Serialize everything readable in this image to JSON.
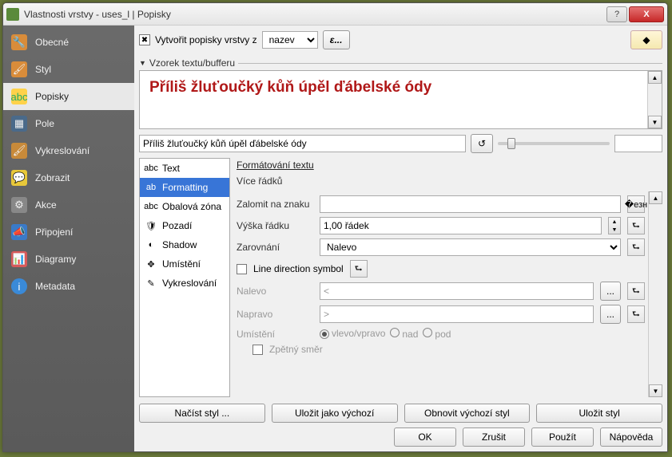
{
  "window": {
    "title": "Vlastnosti vrstvy - uses_l | Popisky"
  },
  "winbtns": {
    "help": "?",
    "close": "X"
  },
  "sidebar": {
    "items": [
      {
        "label": "Obecné"
      },
      {
        "label": "Styl"
      },
      {
        "label": "Popisky"
      },
      {
        "label": "Pole"
      },
      {
        "label": "Vykreslování"
      },
      {
        "label": "Zobrazit"
      },
      {
        "label": "Akce"
      },
      {
        "label": "Připojení"
      },
      {
        "label": "Diagramy"
      },
      {
        "label": "Metadata"
      }
    ]
  },
  "top": {
    "checkbox_label": "Vytvořit popisky vrstvy z",
    "field": "nazev",
    "eps": "ε..."
  },
  "sample": {
    "header": "Vzorek textu/bufferu",
    "preview": "Příliš žluťoučký kůň úpěl ďábelské ódy",
    "input": "Příliš žluťoučký kůň úpěl ďábelské ódy"
  },
  "tabs": [
    "Text",
    "Formatting",
    "Obalová zóna",
    "Pozadí",
    "Shadow",
    "Umístění",
    "Vykreslování"
  ],
  "form": {
    "title": "Formátování textu",
    "subtitle": "Více řádků",
    "wrap_label": "Zalomit na znaku",
    "lineheight_label": "Výška řádku",
    "lineheight_value": "1,00 řádek",
    "align_label": "Zarovnání",
    "align_value": "Nalevo",
    "linedir_label": "Line direction symbol",
    "left_label": "Nalevo",
    "left_value": "<",
    "right_label": "Napravo",
    "right_value": ">",
    "placement_label": "Umístění",
    "placement_opts": [
      "vlevo/vpravo",
      "nad",
      "pod"
    ],
    "reverse_label": "Zpětný směr"
  },
  "stylebar": {
    "load": "Načíst styl ...",
    "save_default": "Uložit jako výchozí",
    "restore": "Obnovit výchozí styl",
    "save": "Uložit styl"
  },
  "dlg": {
    "ok": "OK",
    "cancel": "Zrušit",
    "apply": "Použít",
    "help": "Nápověda"
  }
}
